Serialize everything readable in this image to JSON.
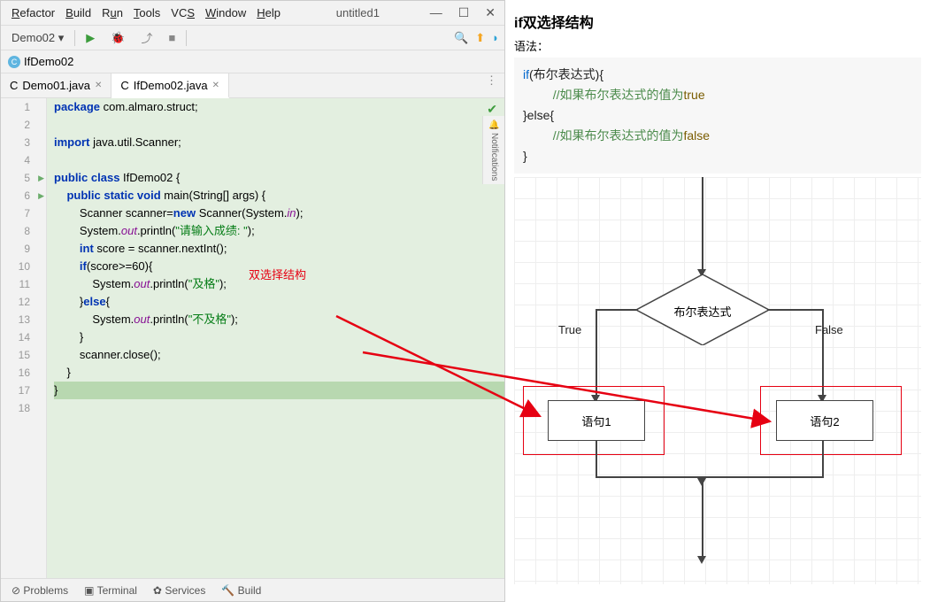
{
  "menu": {
    "items": [
      "Refactor",
      "Build",
      "Run",
      "Tools",
      "VCS",
      "Window",
      "Help"
    ],
    "underlines": [
      "R",
      "B",
      "R",
      "T",
      "V",
      "W",
      "H"
    ],
    "title": "untitled1"
  },
  "toolbar": {
    "config": "Demo02",
    "config_chev": "▾"
  },
  "breadcrumb": {
    "label": "IfDemo02"
  },
  "tabs": [
    {
      "label": "Demo01.java",
      "active": false
    },
    {
      "label": "IfDemo02.java",
      "active": true
    }
  ],
  "code": {
    "lines": [
      "package com.almaro.struct;",
      "",
      "import java.util.Scanner;",
      "",
      "public class IfDemo02 {",
      "    public static void main(String[] args) {",
      "        Scanner scanner=new Scanner(System.in);",
      "        System.out.println(\"请输入成绩: \");",
      "        int score = scanner.nextInt();",
      "        if(score>=60){",
      "            System.out.println(\"及格\");",
      "        }else{",
      "            System.out.println(\"不及格\");",
      "        }",
      "        scanner.close();",
      "    }",
      "}",
      ""
    ],
    "annotation": "双选择结构"
  },
  "bottom": {
    "problems": "Problems",
    "terminal": "Terminal",
    "services": "Services",
    "build": "Build"
  },
  "right": {
    "heading": "if双选择结构",
    "sub": "语法：",
    "snippet_if": "if",
    "snippet_paren": "(布尔表达式){",
    "snippet_cmt_true": "//如果布尔表达式的值为",
    "snippet_true": "true",
    "snippet_else": "}else{",
    "snippet_cmt_false": "//如果布尔表达式的值为",
    "snippet_false": "false",
    "snippet_close": "}"
  },
  "flowchart": {
    "diamond": "布尔表达式",
    "true": "True",
    "false": "False",
    "stmt1": "语句1",
    "stmt2": "语句2"
  }
}
